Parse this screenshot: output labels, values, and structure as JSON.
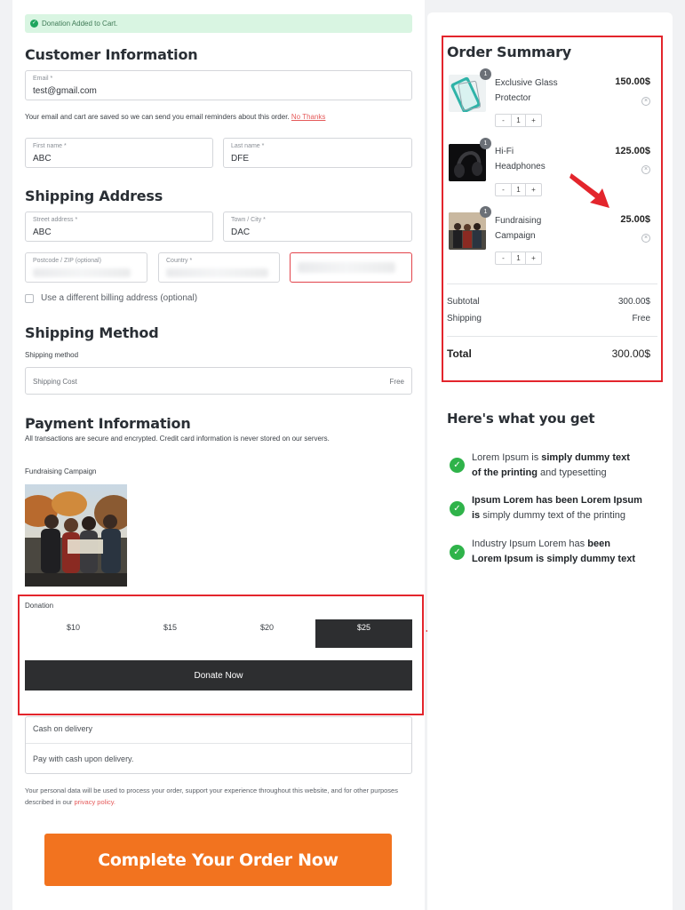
{
  "notice": {
    "icon": "check-circle-icon",
    "text": "Donation Added to Cart."
  },
  "customer": {
    "title": "Customer Information",
    "email_label": "Email *",
    "email_value": "test@gmail.com",
    "reminder_text": "Your email and cart are saved so we can send you email reminders about this order.",
    "no_thanks": "No Thanks",
    "first_name_label": "First name *",
    "first_name_value": "ABC",
    "last_name_label": "Last name *",
    "last_name_value": "DFE"
  },
  "shipping": {
    "title": "Shipping Address",
    "street_label": "Street address *",
    "street_value": "ABC",
    "town_label": "Town / City *",
    "town_value": "DAC",
    "postcode_label": "Postcode / ZIP (optional)",
    "country_label": "Country *",
    "billing_checkbox_label": "Use a different billing address (optional)"
  },
  "shipping_method": {
    "title": "Shipping Method",
    "subtitle": "Shipping method",
    "option_label": "Shipping Cost",
    "option_value": "Free"
  },
  "payment": {
    "title": "Payment Information",
    "secure_text": "All transactions are secure and encrypted. Credit card information is never stored on our servers.",
    "campaign_label": "Fundraising Campaign",
    "donation_label": "Donation",
    "donation_options": [
      "$10",
      "$15",
      "$20",
      "$25"
    ],
    "selected_option": "$25",
    "donate_button": "Donate Now",
    "cod_title": "Cash on delivery",
    "cod_desc": "Pay with cash upon delivery."
  },
  "privacy": {
    "text": "Your personal data will be used to process your order, support your experience throughout this website, and for other purposes described in our",
    "link": "privacy policy."
  },
  "complete_button": "Complete Your Order Now",
  "summary": {
    "title": "Order Summary",
    "items": [
      {
        "name_line1": "Exclusive Glass",
        "name_line2": "Protector",
        "price": "150.00$",
        "qty": "1",
        "badge": "1"
      },
      {
        "name_line1": "Hi-Fi",
        "name_line2": "Headphones",
        "price": "125.00$",
        "qty": "1",
        "badge": "1"
      },
      {
        "name_line1": "Fundraising",
        "name_line2": "Campaign",
        "price": "25.00$",
        "qty": "1",
        "badge": "1"
      }
    ],
    "minus": "-",
    "plus": "+",
    "subtotal_label": "Subtotal",
    "subtotal_value": "300.00$",
    "shipping_label": "Shipping",
    "shipping_value": "Free",
    "total_label": "Total",
    "total_value": "300.00$"
  },
  "benefits": {
    "title": "Here's what you get",
    "items": [
      {
        "pre": "Lorem Ipsum is ",
        "bold1": "simply dummy text",
        "line2_bold": "of the printing",
        "line2_rest": " and typesetting"
      },
      {
        "bold1": "Ipsum Lorem has been Lorem Ipsum",
        "line2_bold": "is",
        "line2_rest": " simply dummy text of the printing"
      },
      {
        "pre": "Industry Ipsum Lorem has ",
        "bold1": "been",
        "line2_bold": "Lorem Ipsum is simply dummy text",
        "line2_rest": ""
      }
    ]
  },
  "colors": {
    "accent_orange": "#f2731f",
    "highlight_red": "#e3252c",
    "dark_button": "#2d2e30",
    "success_green": "#2fb34a"
  }
}
